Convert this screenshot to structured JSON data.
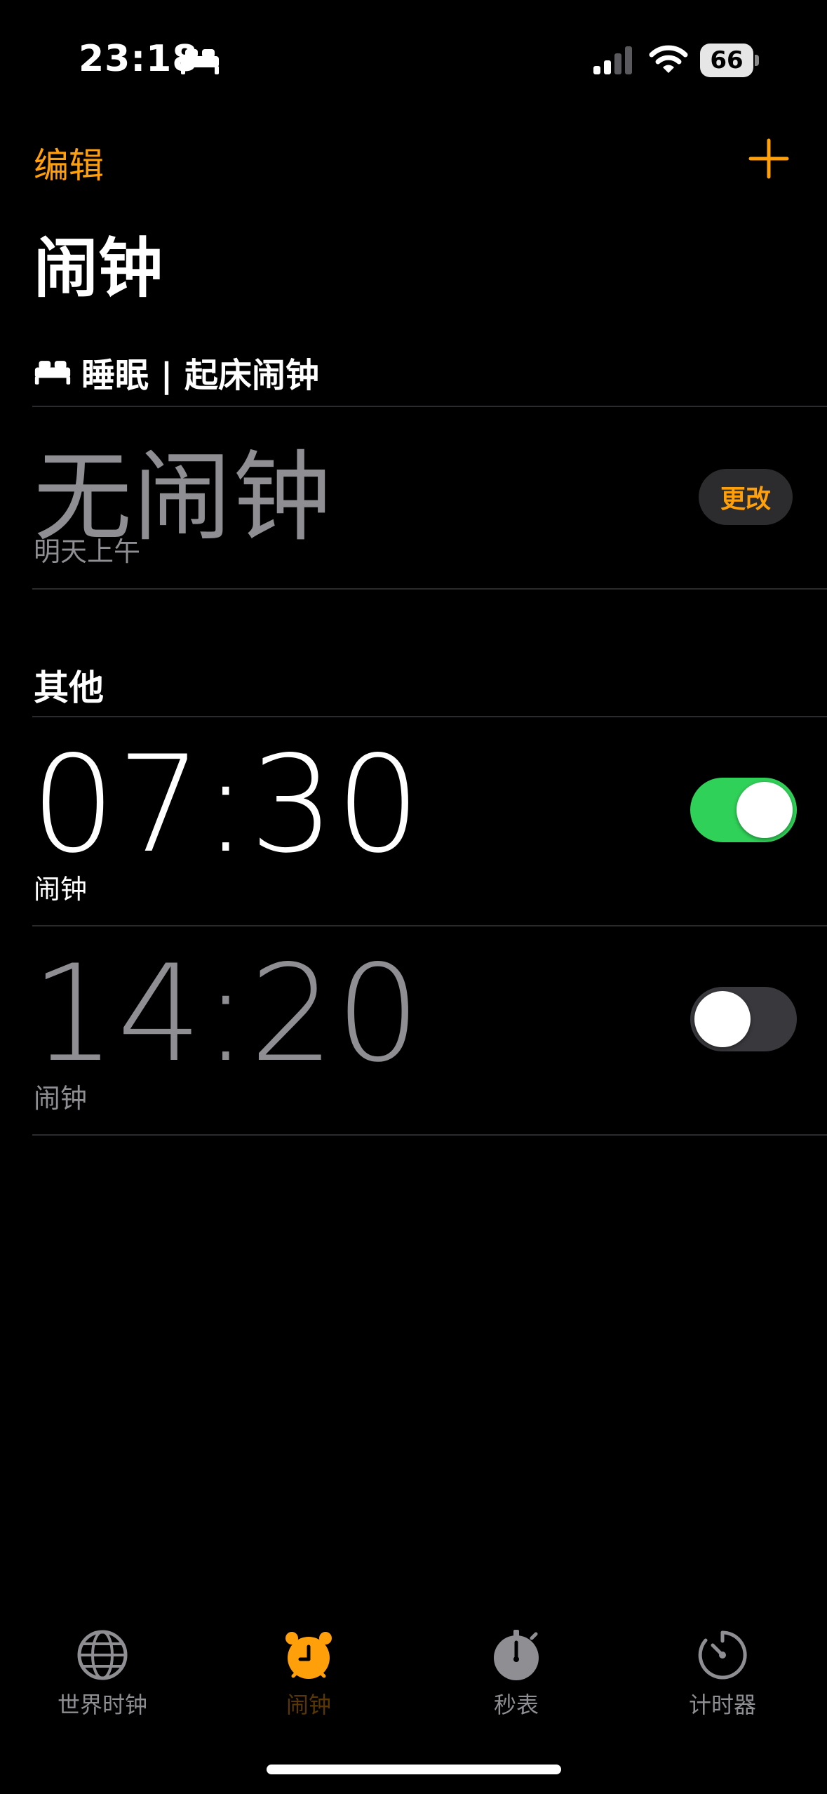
{
  "status_bar": {
    "time": "23:18",
    "battery": "66",
    "icons": [
      "bed-icon",
      "cellular-signal-icon",
      "wifi-icon",
      "battery-icon"
    ]
  },
  "nav": {
    "edit_label": "编辑",
    "add_icon": "plus-icon"
  },
  "page_title": "闹钟",
  "sleep_section": {
    "header": "睡眠 | 起床闹钟",
    "icon": "bed-icon",
    "no_alarm": "无闹钟",
    "subtitle": "明天上午",
    "change_label": "更改"
  },
  "other_section": {
    "header": "其他",
    "alarms": [
      {
        "time": "07:30",
        "label": "闹钟",
        "enabled": true
      },
      {
        "time": "14:20",
        "label": "闹钟",
        "enabled": false
      }
    ]
  },
  "tab_bar": {
    "tabs": [
      {
        "label": "世界时钟",
        "icon": "globe-icon",
        "active": false
      },
      {
        "label": "闹钟",
        "icon": "alarm-clock-icon",
        "active": true
      },
      {
        "label": "秒表",
        "icon": "stopwatch-icon",
        "active": false
      },
      {
        "label": "计时器",
        "icon": "timer-icon",
        "active": false
      }
    ]
  },
  "colors": {
    "accent": "#ff9f0a",
    "toggle_on": "#30d158",
    "secondary_text": "#8e8e93",
    "background": "#000000"
  }
}
